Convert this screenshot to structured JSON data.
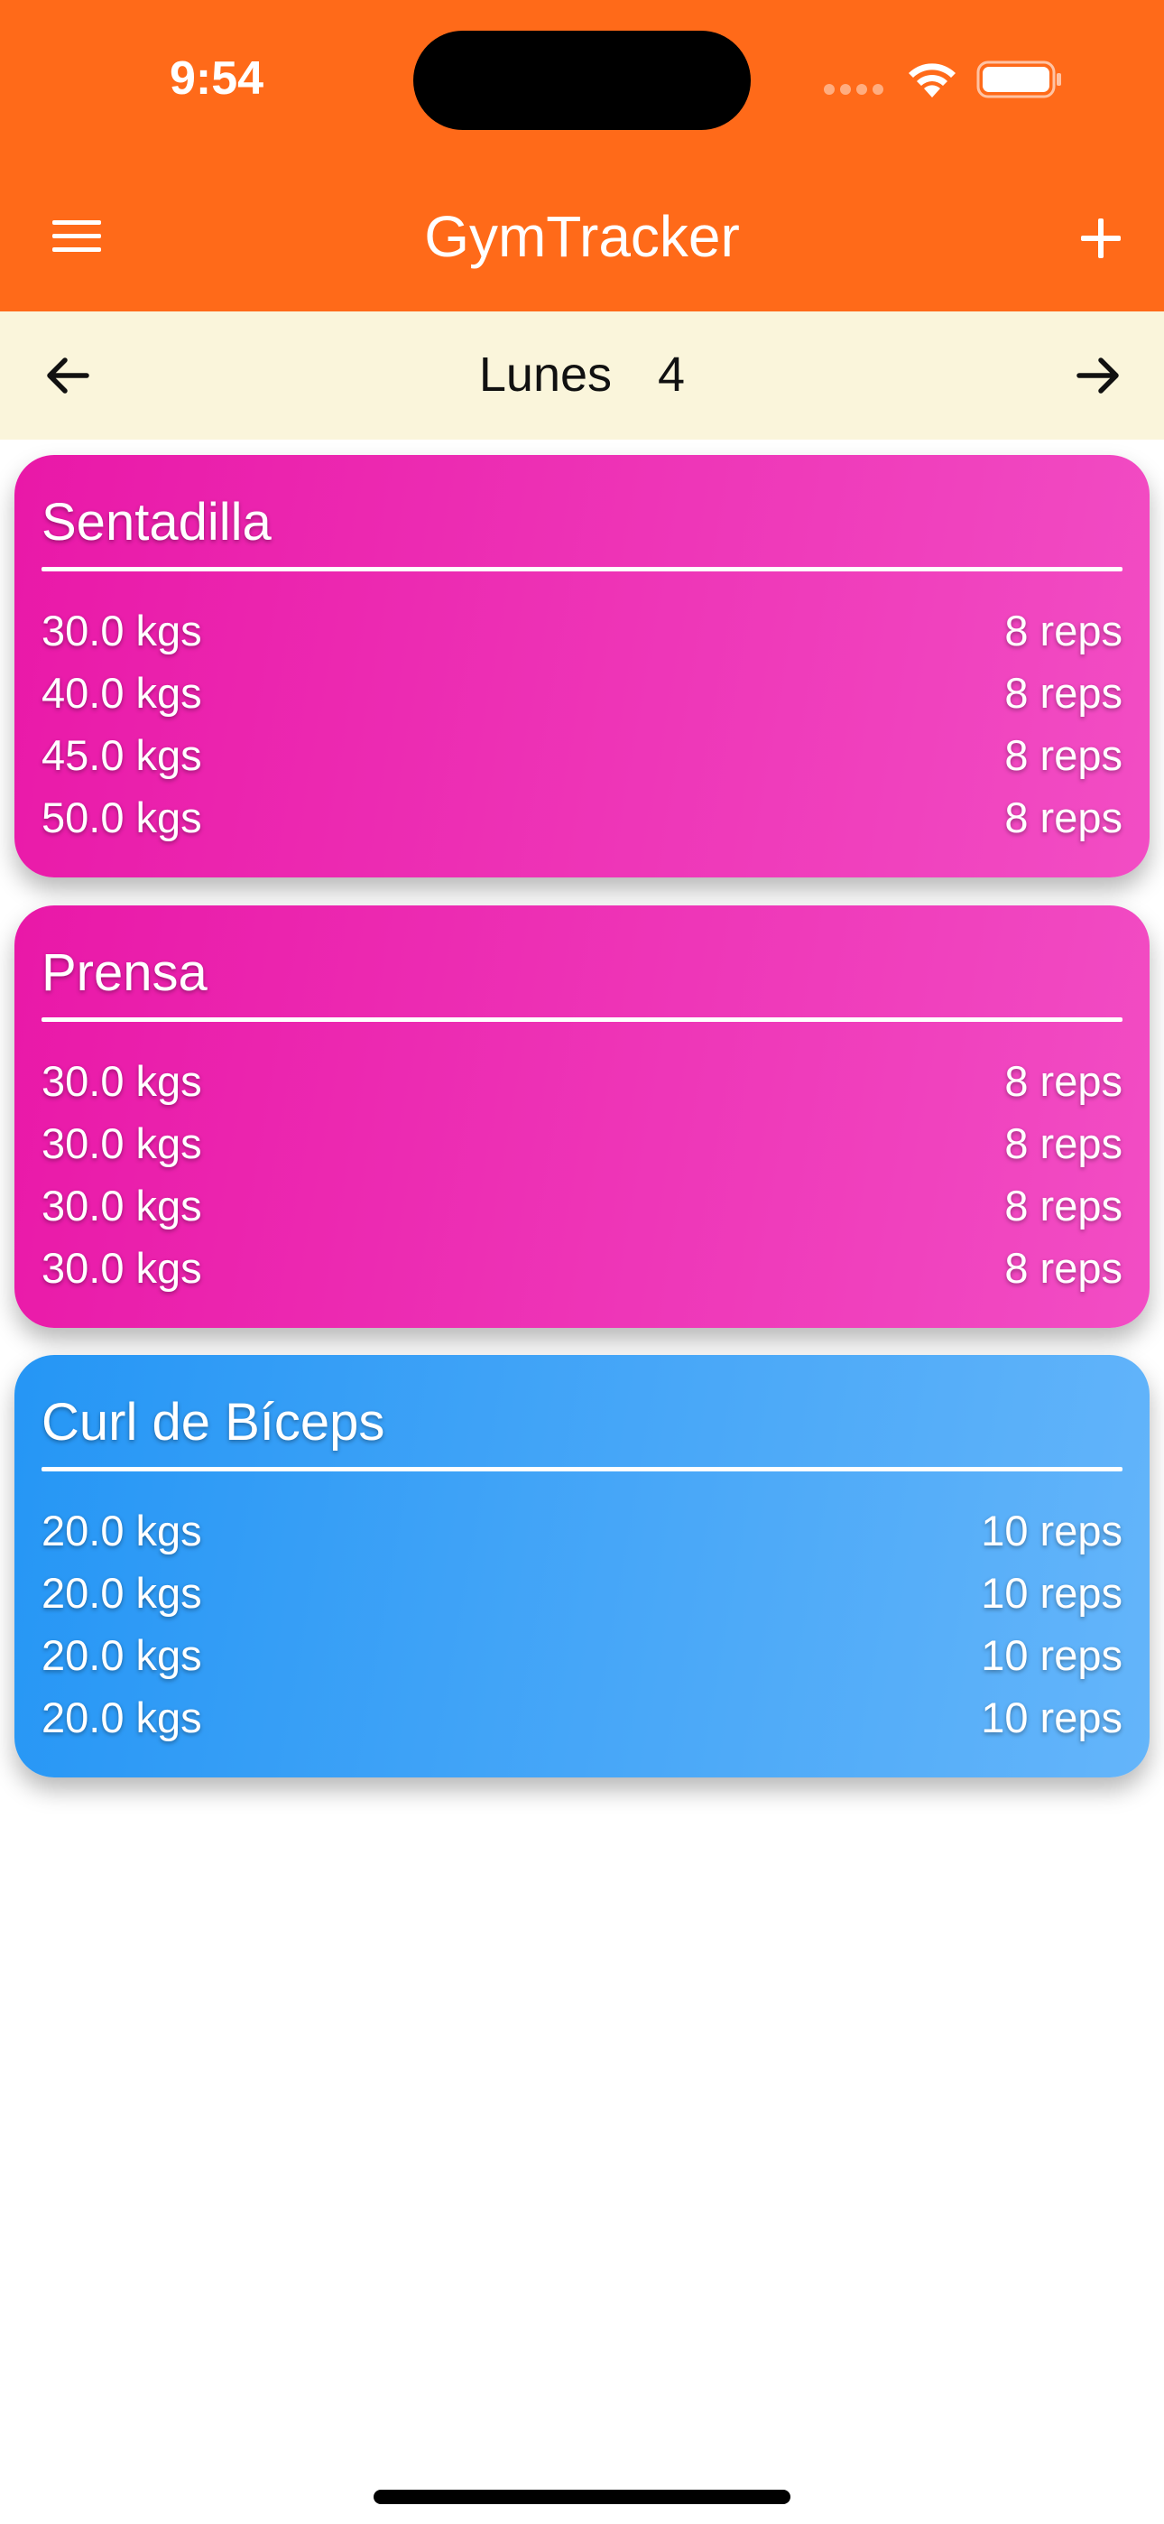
{
  "status_bar": {
    "time": "9:54",
    "icons": [
      "cellular-signal-icon",
      "wifi-icon",
      "battery-icon"
    ]
  },
  "app_bar": {
    "title": "GymTracker",
    "menu_icon": "hamburger-menu-icon",
    "add_icon": "plus-icon",
    "background_color": "#FF6A19"
  },
  "day_nav": {
    "day_name": "Lunes",
    "day_number": "4",
    "prev_icon": "arrow-left-icon",
    "next_icon": "arrow-right-icon",
    "background_color": "#FAF5DB"
  },
  "exercises": [
    {
      "name": "Sentadilla",
      "color": "pink",
      "sets": [
        {
          "weight": "30.0 kgs",
          "reps": "8 reps"
        },
        {
          "weight": "40.0 kgs",
          "reps": "8 reps"
        },
        {
          "weight": "45.0 kgs",
          "reps": "8 reps"
        },
        {
          "weight": "50.0 kgs",
          "reps": "8 reps"
        }
      ]
    },
    {
      "name": "Prensa",
      "color": "pink",
      "sets": [
        {
          "weight": "30.0 kgs",
          "reps": "8 reps"
        },
        {
          "weight": "30.0 kgs",
          "reps": "8 reps"
        },
        {
          "weight": "30.0 kgs",
          "reps": "8 reps"
        },
        {
          "weight": "30.0 kgs",
          "reps": "8 reps"
        }
      ]
    },
    {
      "name": "Curl de Bíceps",
      "color": "blue",
      "sets": [
        {
          "weight": "20.0 kgs",
          "reps": "10 reps"
        },
        {
          "weight": "20.0 kgs",
          "reps": "10 reps"
        },
        {
          "weight": "20.0 kgs",
          "reps": "10 reps"
        },
        {
          "weight": "20.0 kgs",
          "reps": "10 reps"
        }
      ]
    }
  ],
  "colors": {
    "pink_start": "#E918A8",
    "pink_end": "#F24DC4",
    "blue_start": "#2596F5",
    "blue_end": "#64B5FA"
  }
}
